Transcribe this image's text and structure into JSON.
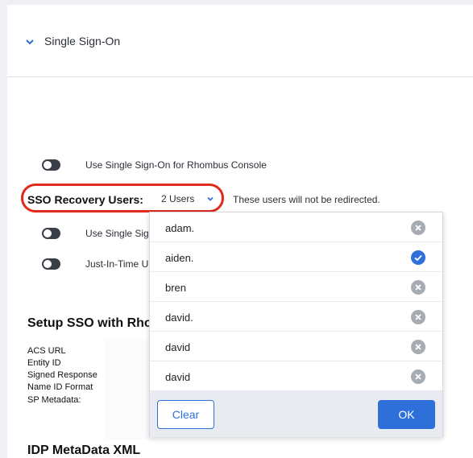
{
  "section": {
    "title": "Single Sign-On"
  },
  "settings": {
    "use_sso_label": "Use Single Sign-On for Rhombus Console",
    "recovery_label": "SSO Recovery Users:",
    "recovery_selected": "2 Users",
    "recovery_note": "These users will not be redirected.",
    "row3_label": "Use Single Sig",
    "row4_label": "Just-In-Time U"
  },
  "setup": {
    "title": "Setup SSO with Rho",
    "fields": [
      "ACS URL",
      "Entity ID",
      "Signed Response",
      "Name ID Format",
      "SP Metadata:"
    ]
  },
  "idp": {
    "title": "IDP MetaData XML"
  },
  "dropdown": {
    "items": [
      {
        "name": "adam.",
        "selected": false
      },
      {
        "name": "aiden.",
        "selected": true
      },
      {
        "name": "bren",
        "selected": false
      },
      {
        "name": "david.",
        "selected": false
      },
      {
        "name": "david",
        "selected": false
      },
      {
        "name": "david",
        "selected": false
      }
    ],
    "clear_label": "Clear",
    "ok_label": "OK"
  },
  "colors": {
    "accent": "#2f6fd9",
    "highlight": "#e02b1c",
    "toggle": "#3a3f47"
  }
}
